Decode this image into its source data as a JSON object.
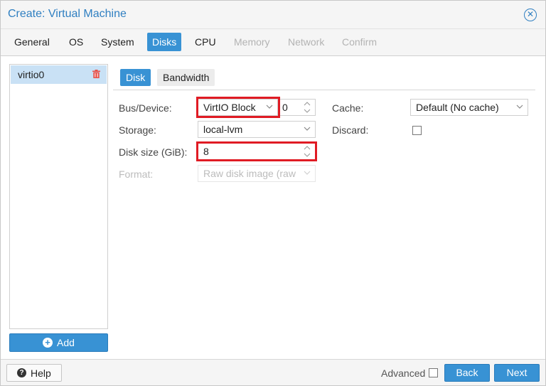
{
  "dialog": {
    "title": "Create: Virtual Machine",
    "close_icon": "close-circle-icon"
  },
  "tabs": [
    {
      "label": "General",
      "state": "normal"
    },
    {
      "label": "OS",
      "state": "normal"
    },
    {
      "label": "System",
      "state": "normal"
    },
    {
      "label": "Disks",
      "state": "active"
    },
    {
      "label": "CPU",
      "state": "normal"
    },
    {
      "label": "Memory",
      "state": "disabled"
    },
    {
      "label": "Network",
      "state": "disabled"
    },
    {
      "label": "Confirm",
      "state": "disabled"
    }
  ],
  "disk_list": {
    "items": [
      {
        "label": "virtio0",
        "delete_icon": "trash-icon"
      }
    ],
    "add_label": "Add",
    "add_icon": "plus-circle-icon"
  },
  "subtabs": [
    {
      "label": "Disk",
      "state": "active"
    },
    {
      "label": "Bandwidth",
      "state": "inactive"
    }
  ],
  "form": {
    "bus_device": {
      "label": "Bus/Device:",
      "bus": "VirtIO Block",
      "device": "0"
    },
    "storage": {
      "label": "Storage:",
      "value": "local-lvm"
    },
    "disk_size": {
      "label": "Disk size (GiB):",
      "value": "8"
    },
    "format": {
      "label": "Format:",
      "value": "Raw disk image (raw"
    },
    "cache": {
      "label": "Cache:",
      "value": "Default (No cache)"
    },
    "discard": {
      "label": "Discard:",
      "checked": false
    }
  },
  "footer": {
    "help_label": "Help",
    "advanced_label": "Advanced",
    "advanced_checked": false,
    "back_label": "Back",
    "next_label": "Next"
  },
  "colors": {
    "accent": "#3892d4",
    "title": "#2f7fc1",
    "highlight": "#e01b24",
    "selected_row": "#c9e1f5",
    "delete": "#e8514a"
  }
}
